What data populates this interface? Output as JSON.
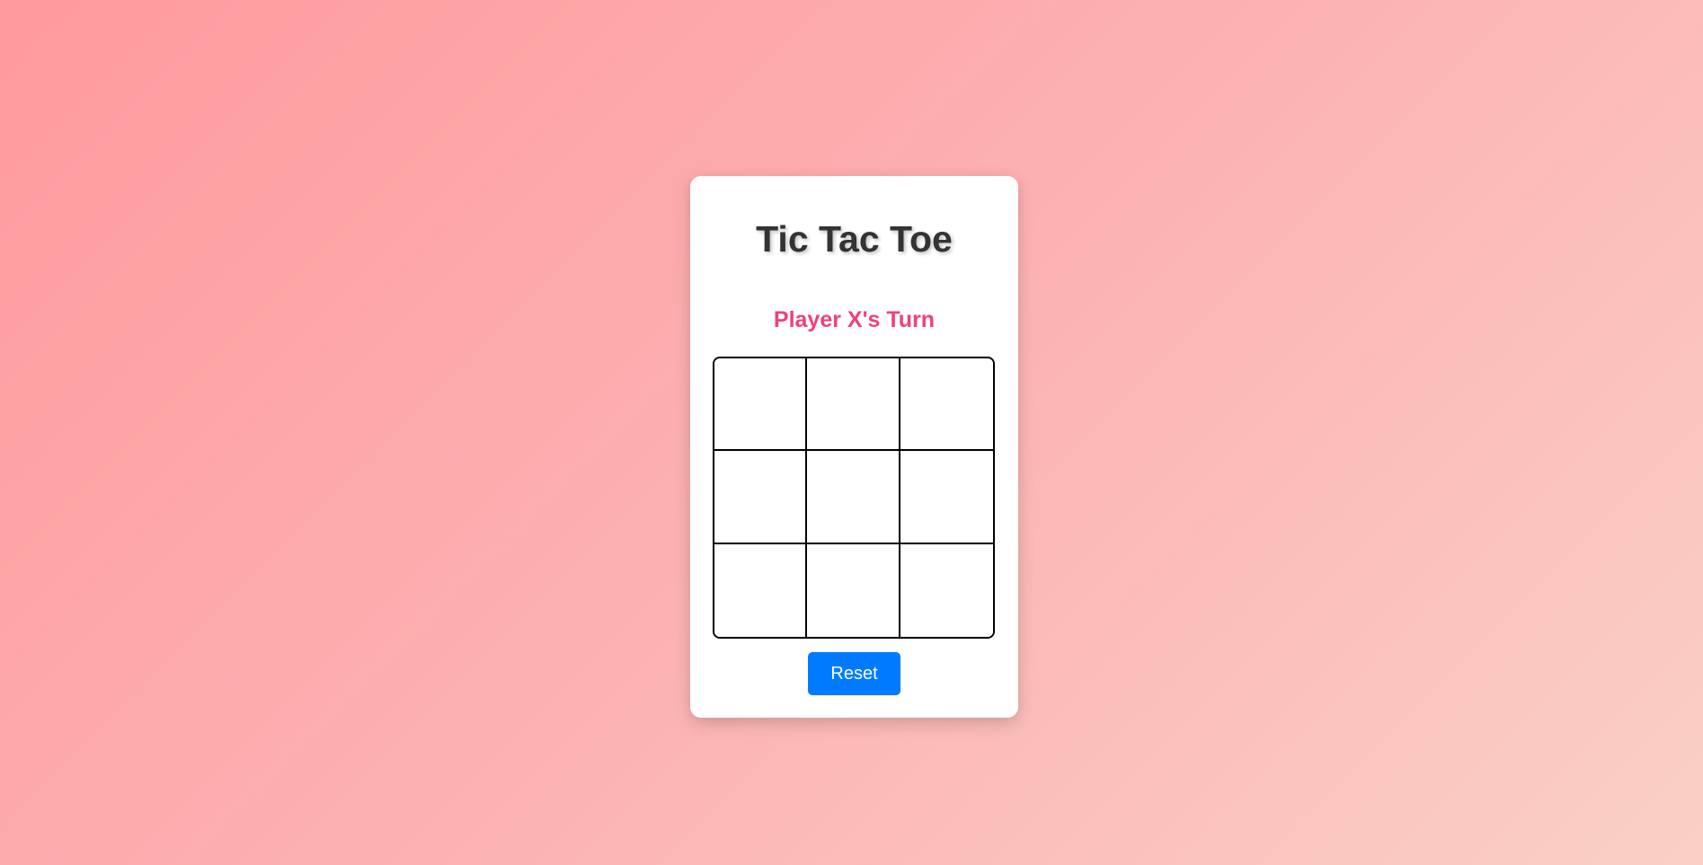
{
  "title": "Tic Tac Toe",
  "status": {
    "text": "Player X's Turn",
    "color": "#f0407a"
  },
  "board": {
    "cells": [
      "",
      "",
      "",
      "",
      "",
      "",
      "",
      "",
      ""
    ]
  },
  "reset": {
    "label": "Reset",
    "color": "#007bff"
  }
}
